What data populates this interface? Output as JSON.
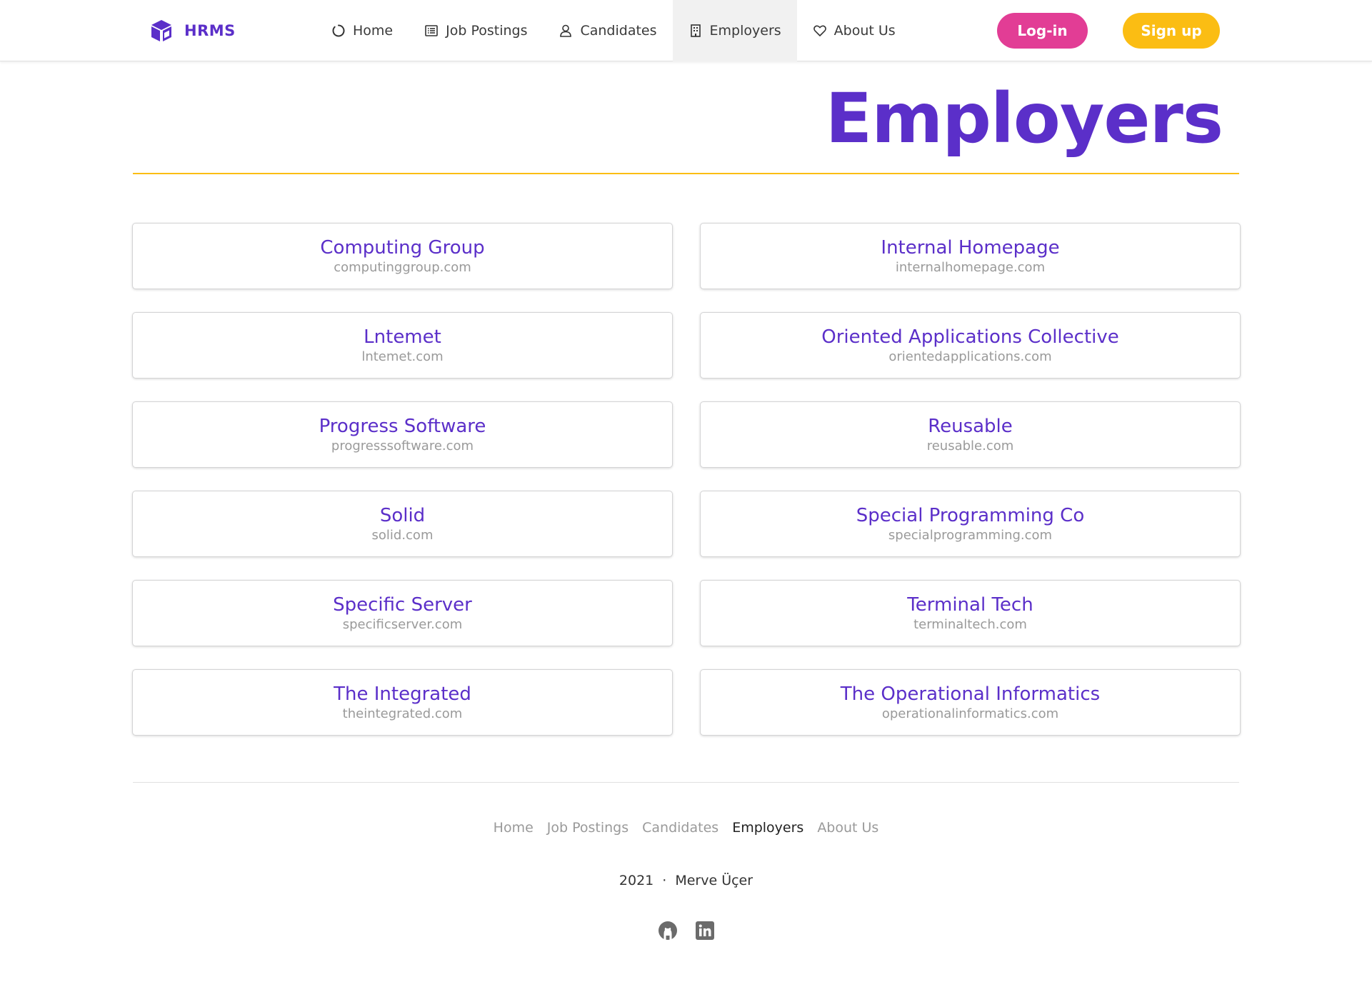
{
  "brand": {
    "name": "HRMS",
    "icon": "cube-icon"
  },
  "colors": {
    "primary": "#5b2fc9",
    "login": "#e23d95",
    "signup": "#fbbd13",
    "muted": "#9a9a9a"
  },
  "nav": {
    "items": [
      {
        "label": "Home",
        "icon": "loader-circle-icon"
      },
      {
        "label": "Job Postings",
        "icon": "list-icon"
      },
      {
        "label": "Candidates",
        "icon": "user-icon"
      },
      {
        "label": "Employers",
        "icon": "building-icon",
        "active": true
      },
      {
        "label": "About Us",
        "icon": "heart-icon"
      }
    ],
    "login_label": "Log-in",
    "signup_label": "Sign up"
  },
  "page": {
    "title": "Employers"
  },
  "employers": [
    {
      "name": "Computing Group",
      "url": "computinggroup.com"
    },
    {
      "name": "Internal Homepage",
      "url": "internalhomepage.com"
    },
    {
      "name": "Lntemet",
      "url": "lntemet.com"
    },
    {
      "name": "Oriented Applications Collective",
      "url": "orientedapplications.com"
    },
    {
      "name": "Progress Software",
      "url": "progresssoftware.com"
    },
    {
      "name": "Reusable",
      "url": "reusable.com"
    },
    {
      "name": "Solid",
      "url": "solid.com"
    },
    {
      "name": "Special Programming Co",
      "url": "specialprogramming.com"
    },
    {
      "name": "Specific Server",
      "url": "specificserver.com"
    },
    {
      "name": "Terminal Tech",
      "url": "terminaltech.com"
    },
    {
      "name": "The Integrated",
      "url": "theintegrated.com"
    },
    {
      "name": "The Operational Informatics",
      "url": "operationalinformatics.com"
    }
  ],
  "footer": {
    "links": [
      "Home",
      "Job Postings",
      "Candidates",
      "Employers",
      "About Us"
    ],
    "active_link": "Employers",
    "year": "2021",
    "separator": "·",
    "author": "Merve Üçer",
    "socials": [
      "github-icon",
      "linkedin-icon"
    ]
  }
}
